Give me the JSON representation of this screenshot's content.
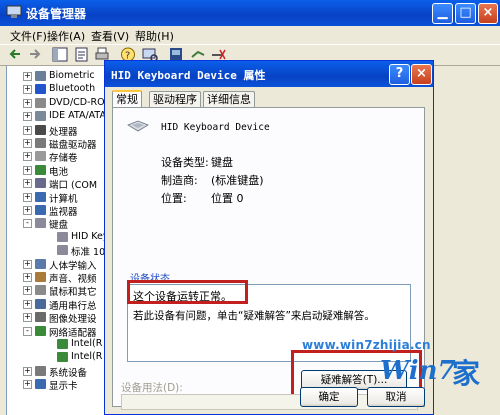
{
  "devmgr": {
    "title": "设备管理器",
    "menu": [
      "文件(F)",
      "操作(A)",
      "查看(V)",
      "帮助(H)"
    ],
    "tree": [
      {
        "label": "Biometric",
        "expand": "+",
        "icon_color": "#6A7F9A",
        "level": 0
      },
      {
        "label": "Bluetooth",
        "expand": "+",
        "icon_color": "#2255CC",
        "level": 0
      },
      {
        "label": "DVD/CD-ROM",
        "expand": "+",
        "icon_color": "#8A8A8A",
        "level": 0
      },
      {
        "label": "IDE ATA/ATA",
        "expand": "+",
        "icon_color": "#7A8A9A",
        "level": 0
      },
      {
        "label": "处理器",
        "expand": "+",
        "icon_color": "#4A4A4A",
        "level": 0
      },
      {
        "label": "磁盘驱动器",
        "expand": "+",
        "icon_color": "#7A7A7A",
        "level": 0
      },
      {
        "label": "存储卷",
        "expand": "+",
        "icon_color": "#9A9A9A",
        "level": 0
      },
      {
        "label": "电池",
        "expand": "+",
        "icon_color": "#3A8A3A",
        "level": 0
      },
      {
        "label": "端口 (COM",
        "expand": "+",
        "icon_color": "#6A6A8A",
        "level": 0
      },
      {
        "label": "计算机",
        "expand": "+",
        "icon_color": "#3A6AB0",
        "level": 0
      },
      {
        "label": "监视器",
        "expand": "+",
        "icon_color": "#3A6AB0",
        "level": 0
      },
      {
        "label": "键盘",
        "expand": "-",
        "icon_color": "#8A8A9A",
        "level": 0
      },
      {
        "label": "HID Key",
        "expand": "",
        "icon_color": "#8A8A9A",
        "level": 1
      },
      {
        "label": "标准 10",
        "expand": "",
        "icon_color": "#8A8A9A",
        "level": 1
      },
      {
        "label": "人体学输入",
        "expand": "+",
        "icon_color": "#5A7AAA",
        "level": 0
      },
      {
        "label": "声音、视频",
        "expand": "+",
        "icon_color": "#AA7A3A",
        "level": 0
      },
      {
        "label": "鼠标和其它",
        "expand": "+",
        "icon_color": "#8A8A8A",
        "level": 0
      },
      {
        "label": "通用串行总",
        "expand": "+",
        "icon_color": "#4A6A9A",
        "level": 0
      },
      {
        "label": "图像处理设",
        "expand": "+",
        "icon_color": "#6A6A6A",
        "level": 0
      },
      {
        "label": "网络适配器",
        "expand": "-",
        "icon_color": "#3A8A3A",
        "level": 0
      },
      {
        "label": "Intel(R",
        "expand": "",
        "icon_color": "#3A8A3A",
        "level": 1
      },
      {
        "label": "Intel(R",
        "expand": "",
        "icon_color": "#3A8A3A",
        "level": 1
      },
      {
        "label": "系统设备",
        "expand": "+",
        "icon_color": "#7A7A7A",
        "level": 0
      },
      {
        "label": "显示卡",
        "expand": "+",
        "icon_color": "#3A6AB0",
        "level": 0
      }
    ]
  },
  "dialog": {
    "title": "HID Keyboard Device 属性",
    "help": "?",
    "close": "×",
    "tabs": [
      "常规",
      "驱动程序",
      "详细信息"
    ],
    "device_name": "HID Keyboard Device",
    "props": [
      {
        "label": "设备类型:",
        "value": "键盘"
      },
      {
        "label": "制造商:",
        "value": "(标准键盘)"
      },
      {
        "label": "位置:",
        "value": "位置 0"
      }
    ],
    "status_group": "设备状态",
    "status_line1": "这个设备运转正常。",
    "status_line2": "若此设备有问题，单击“疑难解答”来启动疑难解答。",
    "troubleshoot": "疑难解答(T)...",
    "usage_label": "设备用法(D):",
    "ok": "确定",
    "cancel": "取消"
  },
  "watermark": {
    "url": "www.win7zhijia.cn",
    "logo_text": "Win7",
    "logo_char": "家"
  },
  "colors": {
    "xp_blue": "#0A5FEA",
    "highlight_red": "#C21F1F"
  }
}
